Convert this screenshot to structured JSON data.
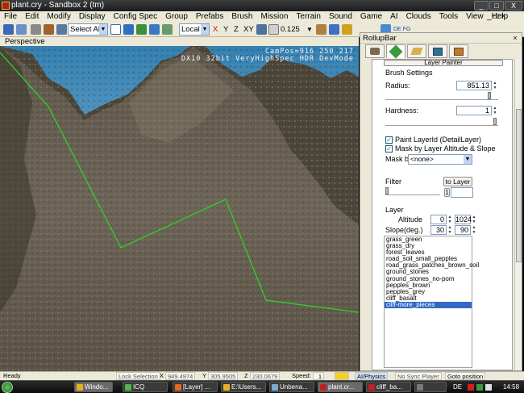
{
  "window": {
    "title": "plant.cry - Sandbox 2 (tm)"
  },
  "menu": [
    "File",
    "Edit",
    "Modify",
    "Display",
    "Config Spec",
    "Group",
    "Prefabs",
    "Brush",
    "Mission",
    "Terrain",
    "Sound",
    "Game",
    "AI",
    "Clouds",
    "Tools",
    "View",
    "Help"
  ],
  "toolbar": {
    "select_filter": "Select All",
    "coord_system": "Local",
    "axes": [
      "X",
      "Y",
      "Z",
      "XY"
    ],
    "grid_value": "0.125",
    "right_labels": "DE FG"
  },
  "viewport": {
    "label": "Perspective",
    "hud_line1": "CamPos=916 250 217",
    "hud_line2": "DX10 32bit VeryHighSpec HDR DevMode"
  },
  "rollup": {
    "title": "RollupBar",
    "close_glyph": "×",
    "tabs": [
      "objects-tab",
      "terrain-tab",
      "modeling-tab",
      "display-tab",
      "layers-tab"
    ],
    "section_header": "Layer Painter",
    "brush_settings": "Brush Settings",
    "radius_label": "Radius:",
    "radius_value": "851.13",
    "radius_level": 0.95,
    "hardness_label": "Hardness:",
    "hardness_value": "1",
    "hardness_level": 1.0,
    "paint_layer_label": "Paint LayerId (DetailLayer)",
    "mask_altitude_label": "Mask by Layer Altitude & Slope",
    "mask_by_label": "Mask by",
    "mask_by_value": "<none>",
    "filter_label": "Filter",
    "to_layer_button": "to Layer",
    "filter_field": "1",
    "layer_label": "Layer",
    "altitude_label": "Altitude",
    "altitude_min": "0",
    "altitude_max": "1024",
    "slope_label": "Slope(deg.)",
    "slope_min": "30",
    "slope_max": "90",
    "layers": [
      "grass_green",
      "grass_dry",
      "forest_leaves",
      "road_soil_small_pepples",
      "road_grass_patches_brown_soil",
      "ground_stones",
      "ground_stones_no-pom",
      "pepples_brown",
      "pepples_grey",
      "cliff_basalt",
      "cliff-more_pieces"
    ],
    "selected_layer": "cliff-more_pieces"
  },
  "statusbar": {
    "left": "Ready",
    "lock_selection": "Lock Selection",
    "x_label": "X",
    "x_value": "949.4974",
    "y_label": "Y",
    "y_value": "305.9505",
    "z_label": "Z",
    "z_value": "230.0679",
    "speed_label": "Speed:",
    "speed_value": "1",
    "ai_physics": "AI/Physics",
    "no_sync_player": "No Sync Player",
    "goto_position": "Goto position"
  },
  "taskbar": {
    "items": [
      "Windo...",
      "ICQ",
      "[Layer] ...",
      "E:\\Users...",
      "Unbena...",
      "plant.cr...",
      "cliff_ba...",
      ""
    ],
    "language": "DE",
    "time": "14:58"
  },
  "colors": {
    "selection": "#316ac5",
    "terrain_line": "#2bd22b",
    "sky": "#4a97c8"
  }
}
